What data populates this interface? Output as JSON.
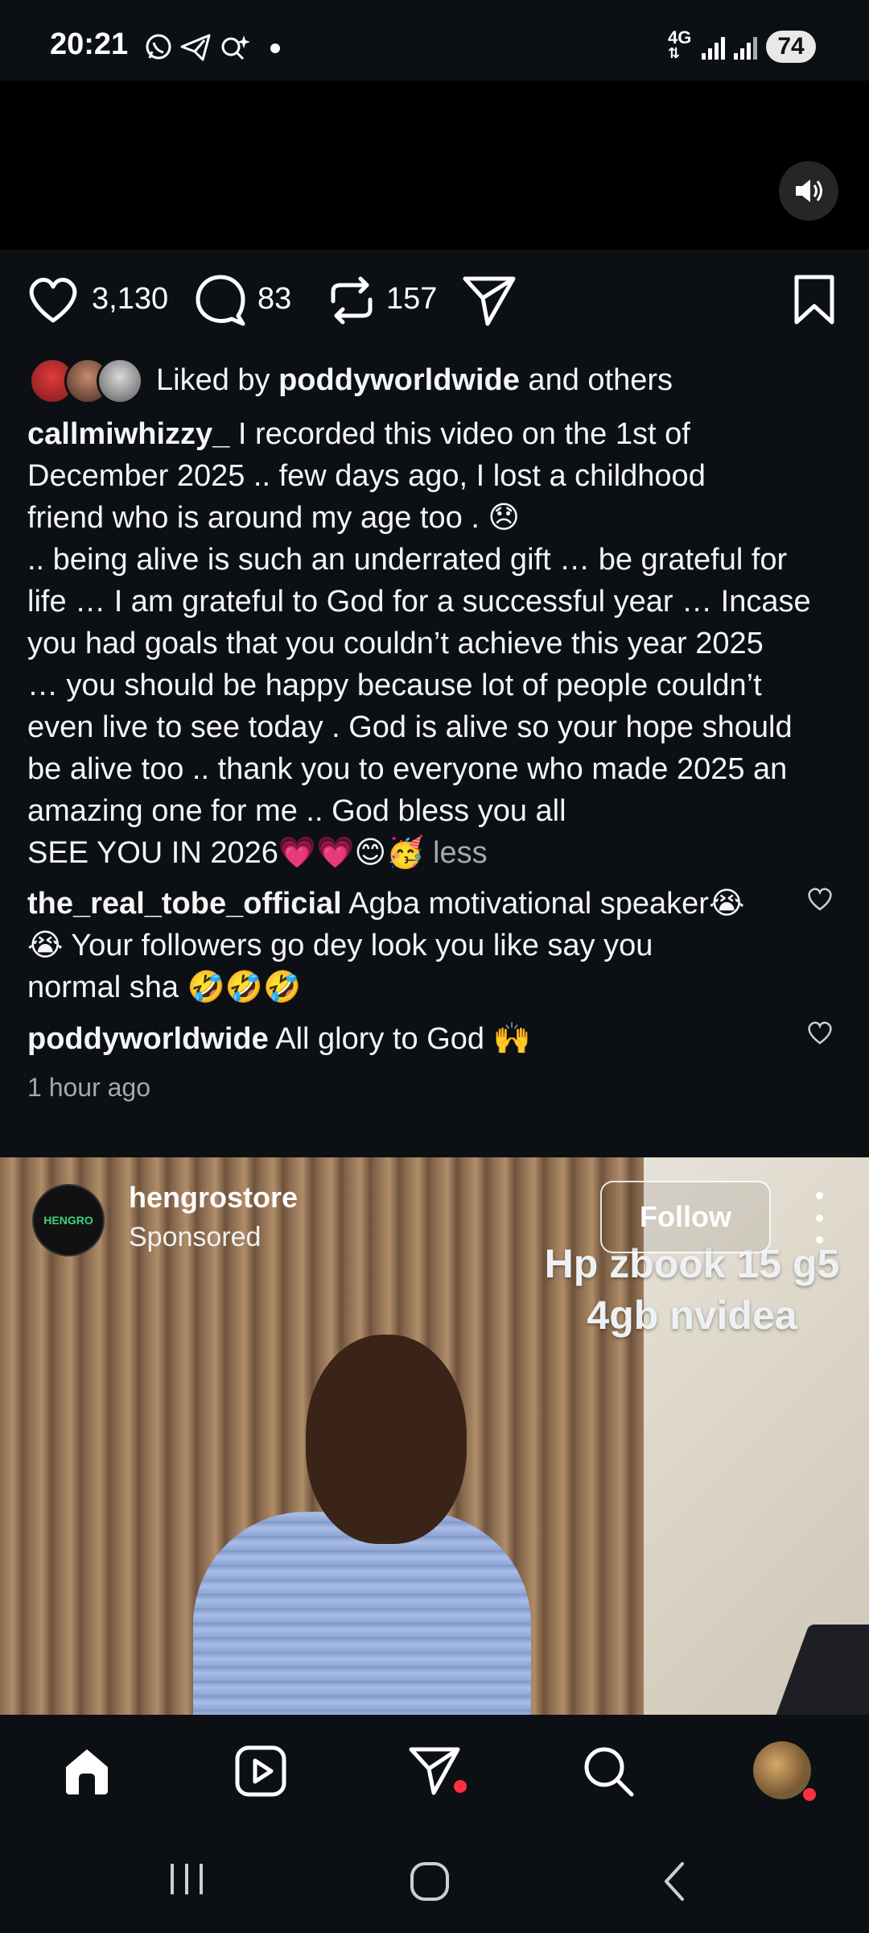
{
  "status_bar": {
    "time": "20:21",
    "network": "4G",
    "battery": "74",
    "icons": [
      "whatsapp-icon",
      "telegram-icon",
      "sparkle-search-icon",
      "dot-icon",
      "signal-icon",
      "signal-icon"
    ]
  },
  "post": {
    "likes": "3,130",
    "comments": "83",
    "reposts": "157",
    "liked_by_prefix": "Liked by ",
    "liked_by_user": "poddyworldwide",
    "liked_by_suffix": " and others",
    "caption_user": "callmiwhizzy_",
    "caption_lines": [
      " I recorded this video on the 1st of",
      "December 2025 .. few days ago, I lost a childhood",
      "friend who is around my age too . 😞",
      ".. being alive is such an underrated gift … be grateful for",
      "life … I am grateful to God  for a successful year … Incase",
      "you had goals that you couldn’t achieve this year 2025",
      "… you should be happy because lot of people couldn’t",
      "even live to see today . God is alive so your hope should",
      "be alive too .. thank you to everyone who made 2025 an",
      "amazing one for me .. God bless you all",
      " SEE YOU IN 2026💗💗😊🥳"
    ],
    "less_label": " less",
    "comments_list": [
      {
        "user": "the_real_tobe_official",
        "lines": [
          " Agba motivational speaker😭",
          "😭 Your followers go dey look you like say you",
          "normal sha 🤣🤣🤣"
        ]
      },
      {
        "user": "poddyworldwide",
        "lines": [
          " All glory to God 🙌"
        ]
      }
    ],
    "timestamp": "1 hour ago"
  },
  "ad": {
    "username": "hengrostore",
    "sponsored": "Sponsored",
    "follow_label": "Follow",
    "logo_text": "HENGRO",
    "overlay_lines": [
      "Hp zbook 15 g5",
      "4gb nvidea"
    ]
  },
  "nav": {
    "items": [
      "home-icon",
      "reels-icon",
      "direct-icon",
      "search-icon",
      "profile-avatar"
    ]
  },
  "colors": {
    "background": "#0c1014",
    "muted_text": "#a8a8a8",
    "notification_red": "#ff3040"
  }
}
